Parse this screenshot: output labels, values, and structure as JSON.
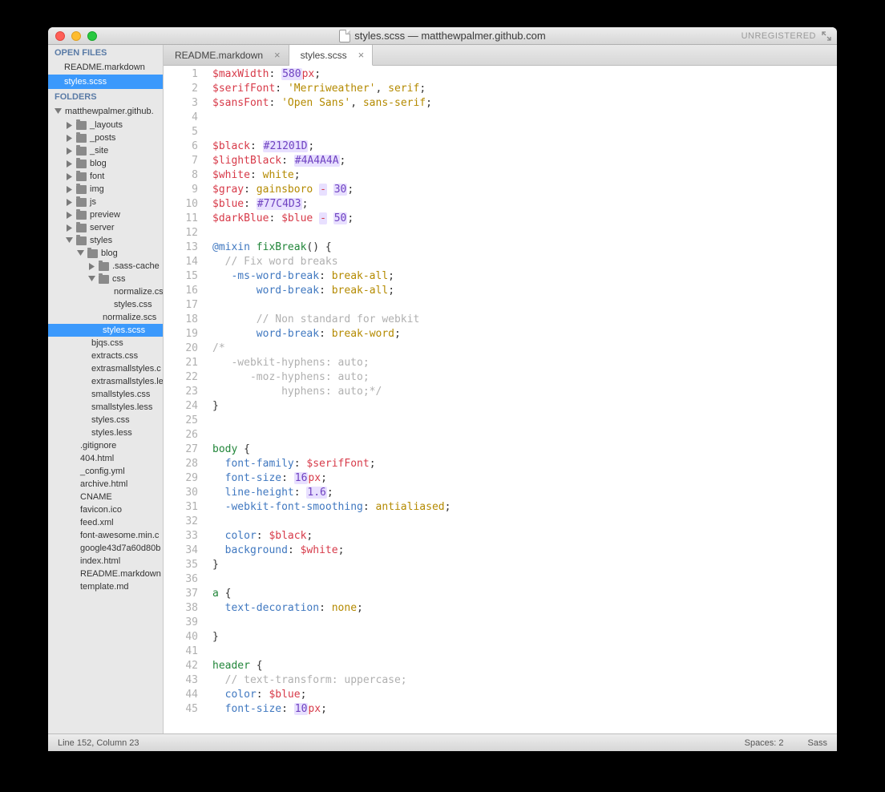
{
  "window": {
    "title": "styles.scss — matthewpalmer.github.com",
    "unregistered": "UNREGISTERED"
  },
  "sidebar": {
    "openFilesHeader": "OPEN FILES",
    "openFiles": [
      {
        "name": "README.markdown",
        "active": false
      },
      {
        "name": "styles.scss",
        "active": true
      }
    ],
    "foldersHeader": "FOLDERS",
    "projectName": "matthewpalmer.github.",
    "tree": [
      {
        "depth": 1,
        "type": "folder",
        "open": false,
        "name": "_layouts"
      },
      {
        "depth": 1,
        "type": "folder",
        "open": false,
        "name": "_posts"
      },
      {
        "depth": 1,
        "type": "folder",
        "open": false,
        "name": "_site"
      },
      {
        "depth": 1,
        "type": "folder",
        "open": false,
        "name": "blog"
      },
      {
        "depth": 1,
        "type": "folder",
        "open": false,
        "name": "font"
      },
      {
        "depth": 1,
        "type": "folder",
        "open": false,
        "name": "img"
      },
      {
        "depth": 1,
        "type": "folder",
        "open": false,
        "name": "js"
      },
      {
        "depth": 1,
        "type": "folder",
        "open": false,
        "name": "preview"
      },
      {
        "depth": 1,
        "type": "folder",
        "open": false,
        "name": "server"
      },
      {
        "depth": 1,
        "type": "folder",
        "open": true,
        "name": "styles"
      },
      {
        "depth": 2,
        "type": "folder",
        "open": true,
        "name": "blog"
      },
      {
        "depth": 3,
        "type": "folder",
        "open": false,
        "name": ".sass-cache"
      },
      {
        "depth": 3,
        "type": "folder",
        "open": true,
        "name": "css"
      },
      {
        "depth": 4,
        "type": "file",
        "name": "normalize.cs"
      },
      {
        "depth": 4,
        "type": "file",
        "name": "styles.css"
      },
      {
        "depth": 3,
        "type": "file",
        "name": "normalize.scs"
      },
      {
        "depth": 3,
        "type": "file",
        "name": "styles.scss",
        "active": true
      },
      {
        "depth": 2,
        "type": "file",
        "name": "bjqs.css"
      },
      {
        "depth": 2,
        "type": "file",
        "name": "extracts.css"
      },
      {
        "depth": 2,
        "type": "file",
        "name": "extrasmallstyles.c"
      },
      {
        "depth": 2,
        "type": "file",
        "name": "extrasmallstyles.le"
      },
      {
        "depth": 2,
        "type": "file",
        "name": "smallstyles.css"
      },
      {
        "depth": 2,
        "type": "file",
        "name": "smallstyles.less"
      },
      {
        "depth": 2,
        "type": "file",
        "name": "styles.css"
      },
      {
        "depth": 2,
        "type": "file",
        "name": "styles.less"
      },
      {
        "depth": 1,
        "type": "file",
        "name": ".gitignore"
      },
      {
        "depth": 1,
        "type": "file",
        "name": "404.html"
      },
      {
        "depth": 1,
        "type": "file",
        "name": "_config.yml"
      },
      {
        "depth": 1,
        "type": "file",
        "name": "archive.html"
      },
      {
        "depth": 1,
        "type": "file",
        "name": "CNAME"
      },
      {
        "depth": 1,
        "type": "file",
        "name": "favicon.ico"
      },
      {
        "depth": 1,
        "type": "file",
        "name": "feed.xml"
      },
      {
        "depth": 1,
        "type": "file",
        "name": "font-awesome.min.c"
      },
      {
        "depth": 1,
        "type": "file",
        "name": "google43d7a60d80b"
      },
      {
        "depth": 1,
        "type": "file",
        "name": "index.html"
      },
      {
        "depth": 1,
        "type": "file",
        "name": "README.markdown"
      },
      {
        "depth": 1,
        "type": "file",
        "name": "template.md"
      }
    ]
  },
  "tabs": [
    {
      "label": "README.markdown",
      "active": false
    },
    {
      "label": "styles.scss",
      "active": true
    }
  ],
  "code": [
    [
      {
        "c": "t-var",
        "t": "$maxWidth"
      },
      {
        "t": ": "
      },
      {
        "c": "t-num hl",
        "t": "580"
      },
      {
        "c": "t-unit",
        "t": "px"
      },
      {
        "t": ";"
      }
    ],
    [
      {
        "c": "t-var",
        "t": "$serifFont"
      },
      {
        "t": ": "
      },
      {
        "c": "t-str",
        "t": "'Merriweather'"
      },
      {
        "t": ", "
      },
      {
        "c": "t-const",
        "t": "serif"
      },
      {
        "t": ";"
      }
    ],
    [
      {
        "c": "t-var",
        "t": "$sansFont"
      },
      {
        "t": ": "
      },
      {
        "c": "t-str",
        "t": "'Open Sans'"
      },
      {
        "t": ", "
      },
      {
        "c": "t-const",
        "t": "sans-serif"
      },
      {
        "t": ";"
      }
    ],
    [],
    [],
    [
      {
        "c": "t-var",
        "t": "$black"
      },
      {
        "t": ": "
      },
      {
        "c": "t-num hl",
        "t": "#21201D"
      },
      {
        "t": ";"
      }
    ],
    [
      {
        "c": "t-var",
        "t": "$lightBlack"
      },
      {
        "t": ": "
      },
      {
        "c": "t-num hl",
        "t": "#4A4A4A"
      },
      {
        "t": ";"
      }
    ],
    [
      {
        "c": "t-var",
        "t": "$white"
      },
      {
        "t": ": "
      },
      {
        "c": "t-const",
        "t": "white"
      },
      {
        "t": ";"
      }
    ],
    [
      {
        "c": "t-var",
        "t": "$gray"
      },
      {
        "t": ": "
      },
      {
        "c": "t-const",
        "t": "gainsboro"
      },
      {
        "t": " "
      },
      {
        "c": "t-op hl",
        "t": "-"
      },
      {
        "t": " "
      },
      {
        "c": "t-num hl",
        "t": "30"
      },
      {
        "t": ";"
      }
    ],
    [
      {
        "c": "t-var",
        "t": "$blue"
      },
      {
        "t": ": "
      },
      {
        "c": "t-num hl",
        "t": "#77C4D3"
      },
      {
        "t": ";"
      }
    ],
    [
      {
        "c": "t-var",
        "t": "$darkBlue"
      },
      {
        "t": ": "
      },
      {
        "c": "t-var",
        "t": "$blue"
      },
      {
        "t": " "
      },
      {
        "c": "t-op hl",
        "t": "-"
      },
      {
        "t": " "
      },
      {
        "c": "t-num hl",
        "t": "50"
      },
      {
        "t": ";"
      }
    ],
    [],
    [
      {
        "c": "t-kw",
        "t": "@mixin"
      },
      {
        "t": " "
      },
      {
        "c": "t-sel",
        "t": "fixBreak"
      },
      {
        "t": "() {"
      }
    ],
    [
      {
        "t": "  "
      },
      {
        "c": "t-com",
        "t": "// Fix word breaks"
      }
    ],
    [
      {
        "t": "   "
      },
      {
        "c": "t-prop",
        "t": "-ms-word-break"
      },
      {
        "t": ": "
      },
      {
        "c": "t-const",
        "t": "break-all"
      },
      {
        "t": ";"
      }
    ],
    [
      {
        "t": "       "
      },
      {
        "c": "t-prop",
        "t": "word-break"
      },
      {
        "t": ": "
      },
      {
        "c": "t-const",
        "t": "break-all"
      },
      {
        "t": ";"
      }
    ],
    [],
    [
      {
        "t": "       "
      },
      {
        "c": "t-com",
        "t": "// Non standard for webkit"
      }
    ],
    [
      {
        "t": "       "
      },
      {
        "c": "t-prop",
        "t": "word-break"
      },
      {
        "t": ": "
      },
      {
        "c": "t-const",
        "t": "break-word"
      },
      {
        "t": ";"
      }
    ],
    [
      {
        "c": "t-com",
        "t": "/*"
      }
    ],
    [
      {
        "c": "t-com",
        "t": "   -webkit-hyphens: auto;"
      }
    ],
    [
      {
        "c": "t-com",
        "t": "      -moz-hyphens: auto;"
      }
    ],
    [
      {
        "c": "t-com",
        "t": "           hyphens: auto;*/"
      }
    ],
    [
      {
        "t": "}"
      }
    ],
    [],
    [],
    [
      {
        "c": "t-sel",
        "t": "body"
      },
      {
        "t": " {"
      }
    ],
    [
      {
        "t": "  "
      },
      {
        "c": "t-prop",
        "t": "font-family"
      },
      {
        "t": ": "
      },
      {
        "c": "t-var",
        "t": "$serifFont"
      },
      {
        "t": ";"
      }
    ],
    [
      {
        "t": "  "
      },
      {
        "c": "t-prop",
        "t": "font-size"
      },
      {
        "t": ": "
      },
      {
        "c": "t-num hl",
        "t": "16"
      },
      {
        "c": "t-unit",
        "t": "px"
      },
      {
        "t": ";"
      }
    ],
    [
      {
        "t": "  "
      },
      {
        "c": "t-prop",
        "t": "line-height"
      },
      {
        "t": ": "
      },
      {
        "c": "t-num hl",
        "t": "1.6"
      },
      {
        "t": ";"
      }
    ],
    [
      {
        "t": "  "
      },
      {
        "c": "t-prop",
        "t": "-webkit-font-smoothing"
      },
      {
        "t": ": "
      },
      {
        "c": "t-const",
        "t": "antialiased"
      },
      {
        "t": ";"
      }
    ],
    [],
    [
      {
        "t": "  "
      },
      {
        "c": "t-prop",
        "t": "color"
      },
      {
        "t": ": "
      },
      {
        "c": "t-var",
        "t": "$black"
      },
      {
        "t": ";"
      }
    ],
    [
      {
        "t": "  "
      },
      {
        "c": "t-prop",
        "t": "background"
      },
      {
        "t": ": "
      },
      {
        "c": "t-var",
        "t": "$white"
      },
      {
        "t": ";"
      }
    ],
    [
      {
        "t": "}"
      }
    ],
    [],
    [
      {
        "c": "t-sel",
        "t": "a"
      },
      {
        "t": " {"
      }
    ],
    [
      {
        "t": "  "
      },
      {
        "c": "t-prop",
        "t": "text-decoration"
      },
      {
        "t": ": "
      },
      {
        "c": "t-const",
        "t": "none"
      },
      {
        "t": ";"
      }
    ],
    [],
    [
      {
        "t": "}"
      }
    ],
    [],
    [
      {
        "c": "t-sel",
        "t": "header"
      },
      {
        "t": " {"
      }
    ],
    [
      {
        "t": "  "
      },
      {
        "c": "t-com",
        "t": "// text-transform: uppercase;"
      }
    ],
    [
      {
        "t": "  "
      },
      {
        "c": "t-prop",
        "t": "color"
      },
      {
        "t": ": "
      },
      {
        "c": "t-var",
        "t": "$blue"
      },
      {
        "t": ";"
      }
    ],
    [
      {
        "t": "  "
      },
      {
        "c": "t-prop",
        "t": "font-size"
      },
      {
        "t": ": "
      },
      {
        "c": "t-num hl",
        "t": "10"
      },
      {
        "c": "t-unit",
        "t": "px"
      },
      {
        "t": ";"
      }
    ]
  ],
  "status": {
    "left": "Line 152, Column 23",
    "spaces": "Spaces: 2",
    "syntax": "Sass"
  }
}
